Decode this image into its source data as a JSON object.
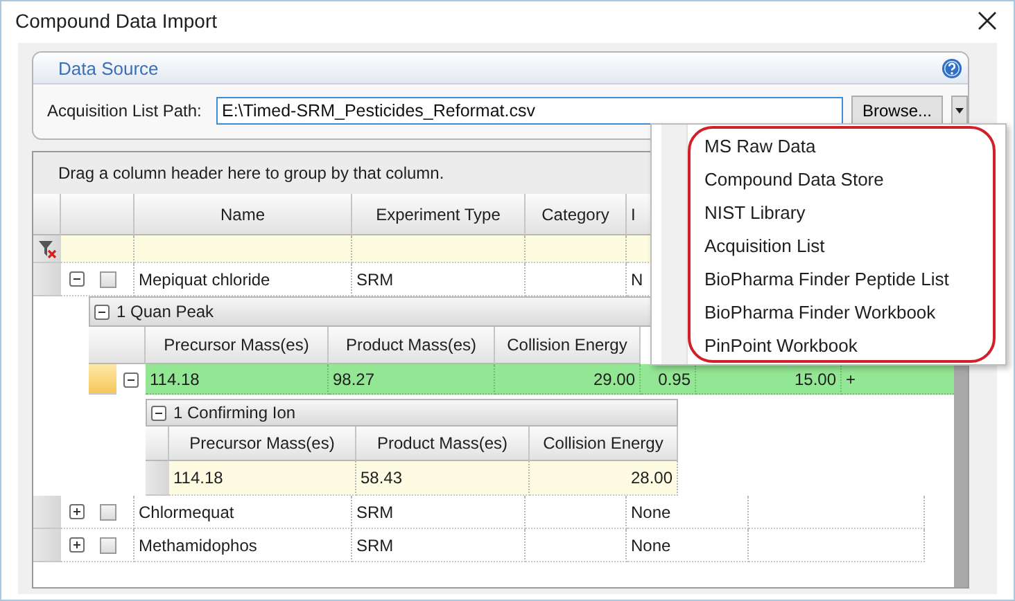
{
  "window": {
    "title": "Compound Data Import"
  },
  "data_source": {
    "title": "Data Source",
    "path_label": "Acquisition List Path:",
    "path_value": "E:\\Timed-SRM_Pesticides_Reformat.csv",
    "browse_button": "Browse..."
  },
  "grid": {
    "group_hint": "Drag a column header here to group by that column.",
    "columns": [
      "Name",
      "Experiment Type",
      "Category",
      "I"
    ],
    "rows": [
      {
        "name": "Mepiquat chloride",
        "experiment_type": "SRM",
        "column_4": "N",
        "expanded": true,
        "checked": false,
        "quan_peak": {
          "title": "1 Quan Peak",
          "columns": [
            "Precursor Mass(es)",
            "Product Mass(es)",
            "Collision Energy"
          ],
          "rows": [
            {
              "values": [
                "114.18",
                "98.27",
                "29.00",
                "0.95",
                "15.00",
                "+"
              ],
              "expanded": true,
              "selected": true
            }
          ],
          "confirming": {
            "title": "1 Confirming Ion",
            "columns": [
              "Precursor Mass(es)",
              "Product Mass(es)",
              "Collision Energy"
            ],
            "rows": [
              {
                "values": [
                  "114.18",
                  "58.43",
                  "28.00"
                ]
              }
            ]
          }
        }
      },
      {
        "name": "Chlormequat",
        "experiment_type": "SRM",
        "column_4": "None",
        "expanded": false,
        "checked": false
      },
      {
        "name": "Methamidophos",
        "experiment_type": "SRM",
        "column_4": "None",
        "expanded": false,
        "checked": false
      }
    ]
  },
  "source_menu": {
    "items": [
      "MS Raw Data",
      "Compound Data Store",
      "NIST Library",
      "Acquisition List",
      "BioPharma Finder Peptide List",
      "BioPharma Finder Workbook",
      "PinPoint Workbook"
    ]
  }
}
